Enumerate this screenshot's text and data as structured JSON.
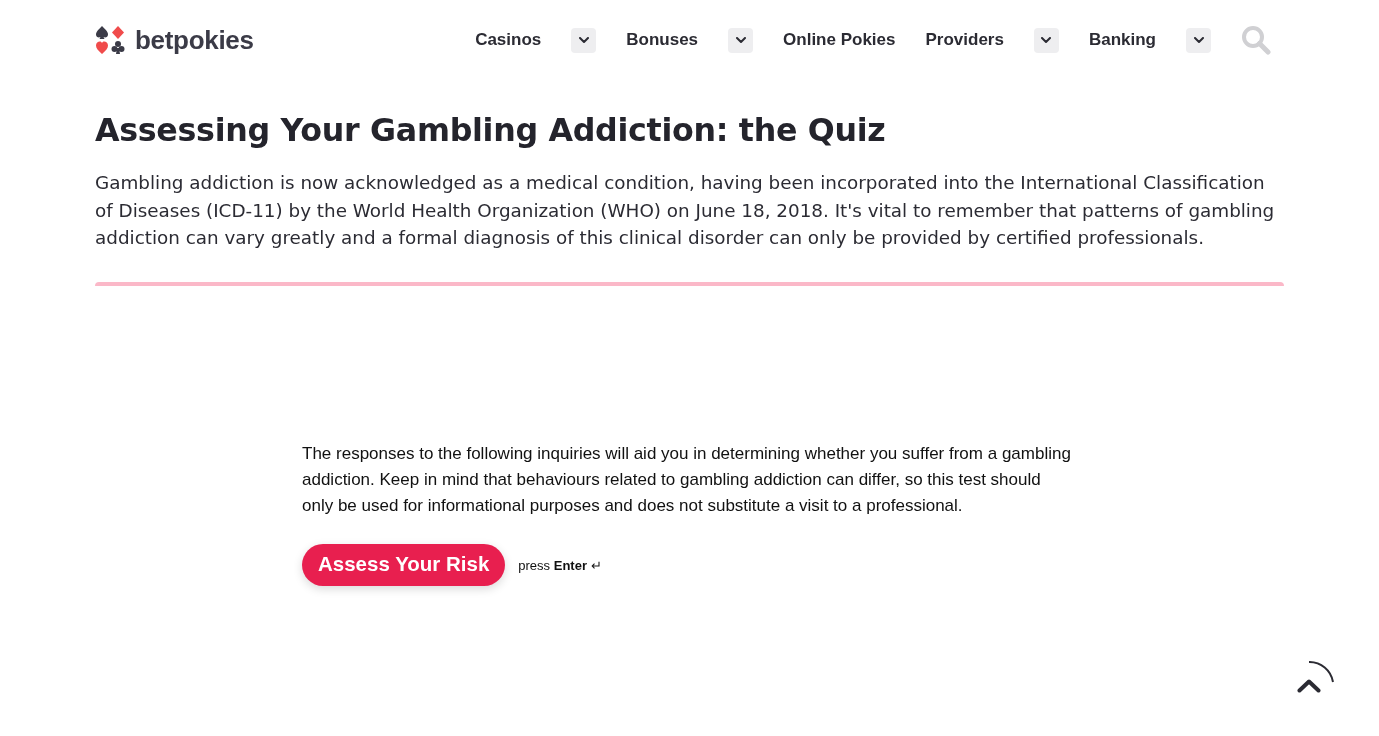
{
  "header": {
    "logo": {
      "text": "betpokies"
    },
    "nav": [
      {
        "label": "Casinos",
        "has_dropdown": true
      },
      {
        "label": "Bonuses",
        "has_dropdown": true
      },
      {
        "label": "Online Pokies",
        "has_dropdown": false
      },
      {
        "label": "Providers",
        "has_dropdown": true
      },
      {
        "label": "Banking",
        "has_dropdown": true
      }
    ]
  },
  "article": {
    "title": "Assessing Your Gambling Addiction: the Quiz",
    "intro": "Gambling addiction is now acknowledged as a medical condition, having been incorporated into the International Classification of Diseases (ICD-11) by the World Health Organization (WHO) on June 18, 2018. It's vital to remember that patterns of gambling addiction can vary greatly and a formal diagnosis of this clinical disorder can only be provided by certified professionals."
  },
  "quiz": {
    "description": "The responses to the following inquiries will aid you in determining whether you suffer from a gambling addiction. Keep in mind that behaviours related to gambling addiction can differ, so this test should only be used for informational purposes and does not substitute a visit to a professional.",
    "start_button": "Assess Your Risk",
    "hint": "press **Enter** ↵"
  }
}
